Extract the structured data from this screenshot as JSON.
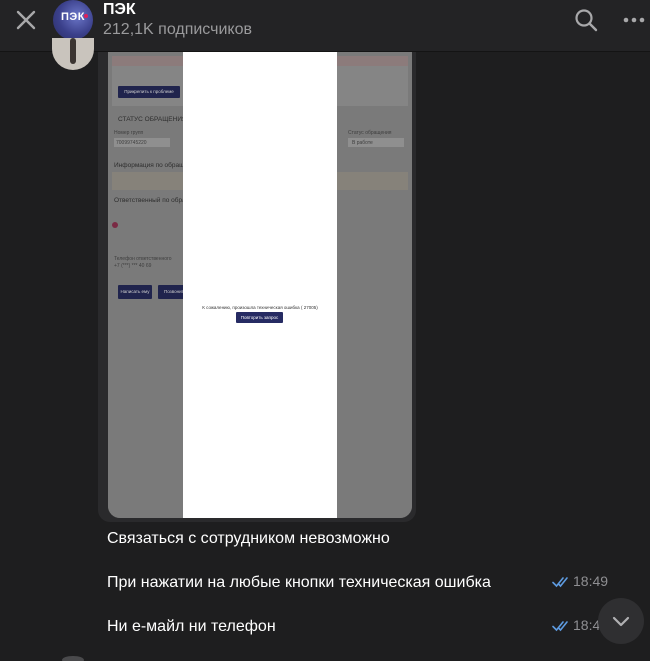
{
  "header": {
    "channel_name": "ПЭК",
    "subscribers": "212,1K подписчиков",
    "avatar_text": "ПЭК",
    "icons": {
      "close": "close-icon",
      "search": "search-icon",
      "more": "more-horizontal-icon"
    }
  },
  "screenshot": {
    "underlay": {
      "status_title": "СТАТУС ОБРАЩЕНИЯ",
      "request_number_label": "Номер групп",
      "request_number_value": "70099745220",
      "status_label": "Статус обращения",
      "status_value": "В работе",
      "info_title": "Информация по обращению",
      "responsible_title": "Ответственный по обращению",
      "phone_label": "Телефон ответственного",
      "phone_value": "+7 (***) *** 40 69",
      "btn_write": "Написать ему",
      "btn_call": "Позвонить",
      "btn_top": "Прикрепить к проблеме"
    },
    "modal": {
      "message": "К сожалению, произошла техническая ошибка ( 27005)",
      "retry_button": "Повторить запрос"
    }
  },
  "messages": [
    {
      "text": "Связаться с сотрудником невозможно",
      "time": ""
    },
    {
      "text": "При нажатии на любые кнопки техническая ошибка",
      "time": "18:49"
    },
    {
      "text": "Ни е-майл ни телефон",
      "time": "18:4"
    }
  ],
  "colors": {
    "background": "#1e1e1f",
    "header": "#232325",
    "check_blue": "#5e9be0",
    "meta_gray": "#8f8f92",
    "brand_navy": "#262b63"
  }
}
